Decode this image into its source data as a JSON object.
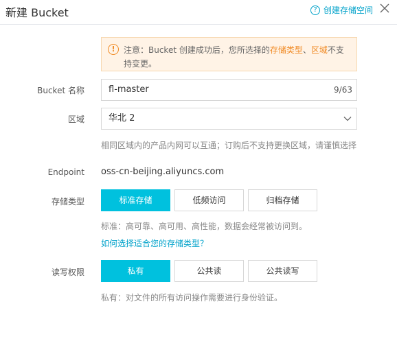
{
  "header": {
    "title": "新建 Bucket",
    "help_label": "创建存储空间"
  },
  "notice": {
    "text_1": "注意：Bucket 创建成功后，您所选择的",
    "highlight_1": "存储类型",
    "sep": "、",
    "highlight_2": "区域",
    "text_2": "不支持变更。"
  },
  "form": {
    "bucket_name": {
      "label": "Bucket 名称",
      "value": "fl-master",
      "count": "9/63"
    },
    "region": {
      "label": "区域",
      "value": "华北 2",
      "hint": "相同区域内的产品内网可以互通；订购后不支持更换区域，请谨慎选择"
    },
    "endpoint": {
      "label": "Endpoint",
      "value": "oss-cn-beijing.aliyuncs.com"
    },
    "storage_class": {
      "label": "存储类型",
      "options": [
        "标准存储",
        "低频访问",
        "归档存储"
      ],
      "selected": "标准存储",
      "hint": "标准：高可靠、高可用、高性能，数据会经常被访问到。",
      "link": "如何选择适合您的存储类型？"
    },
    "acl": {
      "label": "读写权限",
      "options": [
        "私有",
        "公共读",
        "公共读写"
      ],
      "selected": "私有",
      "hint": "私有：对文件的所有访问操作需要进行身份验证。"
    }
  },
  "colors": {
    "accent": "#00c1de",
    "link": "#00a2ca",
    "warning": "#f08a24",
    "notice_bg": "#fff3e6"
  },
  "icons": {
    "help": "help-circle-icon",
    "close": "close-icon",
    "notice": "warning-circle-icon",
    "dropdown": "chevron-down-icon"
  }
}
